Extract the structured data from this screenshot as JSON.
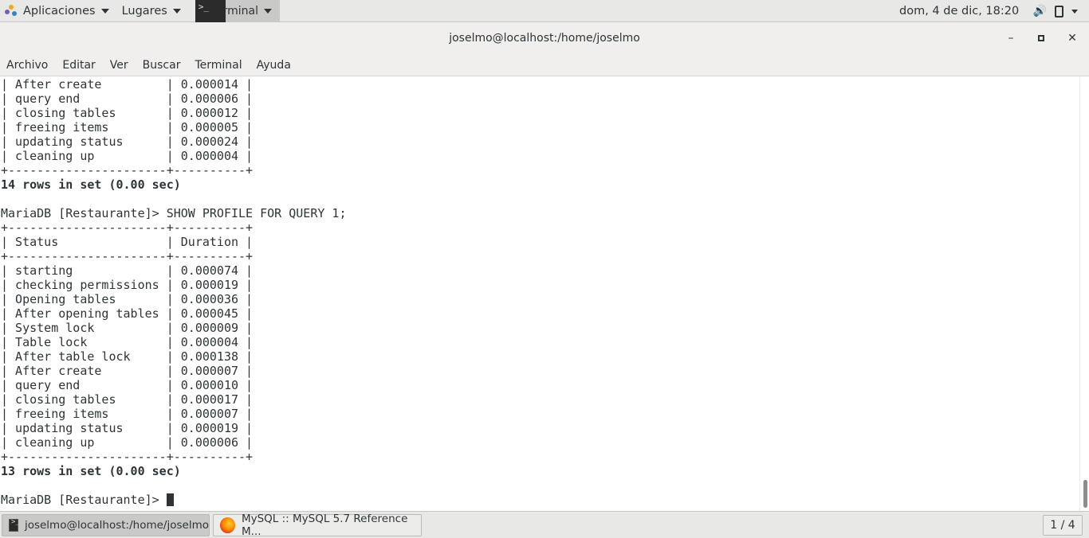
{
  "top_panel": {
    "applications_label": "Aplicaciones",
    "places_label": "Lugares",
    "active_app_label": "Terminal",
    "clock": "dom,  4 de dic, 18:20"
  },
  "window": {
    "title": "joselmo@localhost:/home/joselmo",
    "minimize": "–",
    "maximize": "▫",
    "close": "✕"
  },
  "menubar": [
    "Archivo",
    "Editar",
    "Ver",
    "Buscar",
    "Terminal",
    "Ayuda"
  ],
  "terminal": {
    "lines": [
      "| After create         | 0.000014 |",
      "| query end            | 0.000006 |",
      "| closing tables       | 0.000012 |",
      "| freeing items        | 0.000005 |",
      "| updating status      | 0.000024 |",
      "| cleaning up          | 0.000004 |",
      "+----------------------+----------+",
      "14 rows in set (0.00 sec)",
      "",
      "MariaDB [Restaurante]> SHOW PROFILE FOR QUERY 1;",
      "+----------------------+----------+",
      "| Status               | Duration |",
      "+----------------------+----------+",
      "| starting             | 0.000074 |",
      "| checking permissions | 0.000019 |",
      "| Opening tables       | 0.000036 |",
      "| After opening tables | 0.000045 |",
      "| System lock          | 0.000009 |",
      "| Table lock           | 0.000004 |",
      "| After table lock     | 0.000138 |",
      "| After create         | 0.000007 |",
      "| query end            | 0.000010 |",
      "| closing tables       | 0.000017 |",
      "| freeing items        | 0.000007 |",
      "| updating status      | 0.000019 |",
      "| cleaning up          | 0.000006 |",
      "+----------------------+----------+",
      "13 rows in set (0.00 sec)",
      "",
      "MariaDB [Restaurante]> "
    ],
    "bold_lines": [
      7,
      27
    ]
  },
  "taskbar": {
    "tasks": [
      {
        "label": "joselmo@localhost:/home/joselmo",
        "icon": "terminal-icon",
        "active": true
      },
      {
        "label": "MySQL :: MySQL 5.7 Reference M...",
        "icon": "firefox-icon",
        "active": false
      }
    ],
    "workspace": "1 / 4"
  },
  "colors": {
    "panel_bg": "#e8e8e7",
    "titlebar_bg": "#f0efee",
    "terminal_fg": "#2e3436",
    "terminal_bg": "#ffffff"
  }
}
